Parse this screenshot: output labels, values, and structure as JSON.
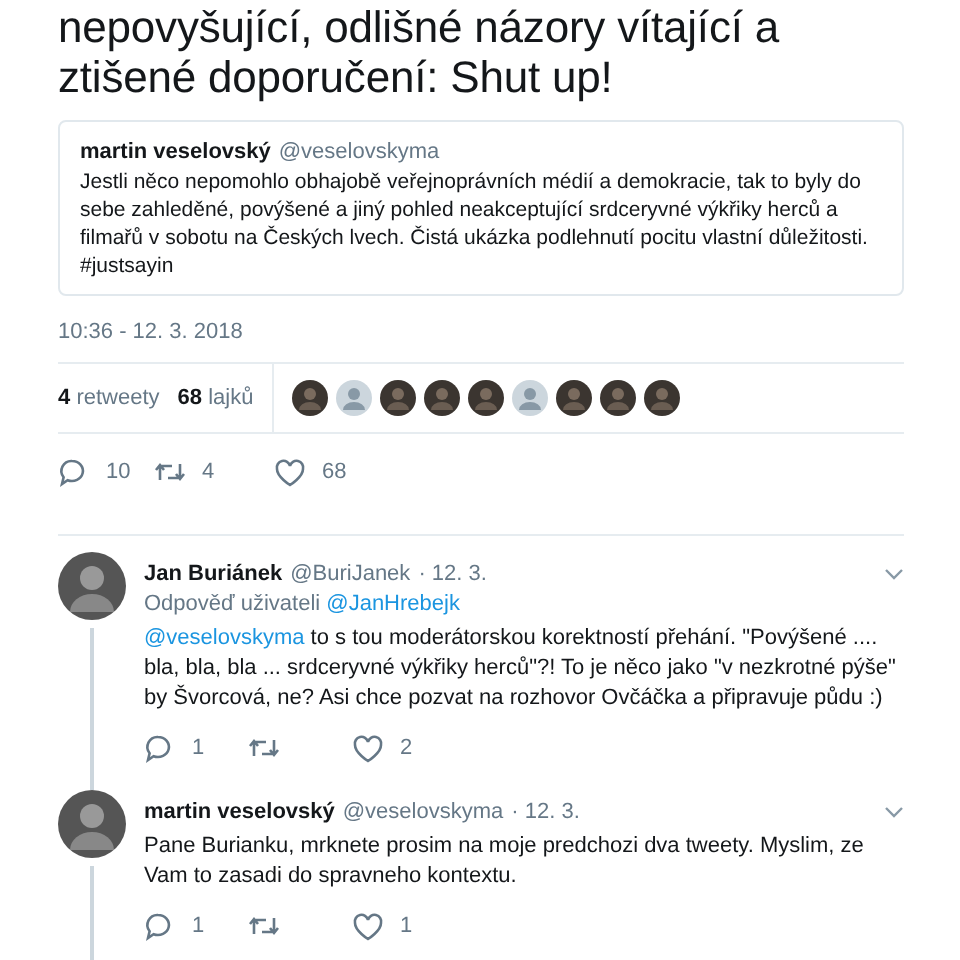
{
  "tweet": {
    "text_tail": "nepovyšující, odlišné názory vítající a ztišené doporučení: Shut up!",
    "quote": {
      "name": "martin veselovský",
      "handle": "@veselovskyma",
      "text": "Jestli něco nepomohlo obhajobě veřejnoprávních médií a demokracie, tak to byly do sebe zahleděné, povýšené a jiný pohled neakceptující srdceryvné výkřiky herců a filmařů v sobotu na Českých lvech. Čistá ukázka podlehnutí pocitu vlastní důležitosti. #justsayin"
    },
    "timestamp": "10:36 - 12. 3. 2018",
    "stats": [
      {
        "count": "4",
        "label": "retweety"
      },
      {
        "count": "68",
        "label": "lajků"
      }
    ],
    "likers": [
      {
        "kind": "photo"
      },
      {
        "kind": "default"
      },
      {
        "kind": "photo"
      },
      {
        "kind": "photo"
      },
      {
        "kind": "photo"
      },
      {
        "kind": "default"
      },
      {
        "kind": "photo"
      },
      {
        "kind": "photo"
      },
      {
        "kind": "photo"
      }
    ],
    "actions": [
      {
        "kind": "reply",
        "count": "10"
      },
      {
        "kind": "retweet",
        "count": "4"
      },
      {
        "kind": "like",
        "count": "68"
      }
    ]
  },
  "replies": [
    {
      "name": "Jan Buriánek",
      "handle": "@BuriJanek",
      "date": "· 12. 3.",
      "reply_to_label": "Odpověď uživateli",
      "reply_to": "@JanHrebejk",
      "mention": "@veselovskyma",
      "text": " to s tou moderátorskou korektností přehání. \"Povýšené .... bla, bla, bla ... srdceryvné výkřiky herců\"?! To je něco jako \"v nezkrotné pýše\" by Švorcová, ne? Asi chce pozvat na rozhovor Ovčáčka a připravuje půdu :)",
      "actions": [
        {
          "kind": "reply",
          "count": "1"
        },
        {
          "kind": "retweet"
        },
        {
          "kind": "like",
          "count": "2"
        }
      ]
    },
    {
      "name": "martin veselovský",
      "handle": "@veselovskyma",
      "date": "· 12. 3.",
      "text": "Pane Burianku, mrknete prosim na moje predchozi dva tweety. Myslim, ze Vam to zasadi do spravneho kontextu.",
      "actions": [
        {
          "kind": "reply",
          "count": "1"
        },
        {
          "kind": "retweet"
        },
        {
          "kind": "like",
          "count": "1"
        }
      ]
    }
  ]
}
